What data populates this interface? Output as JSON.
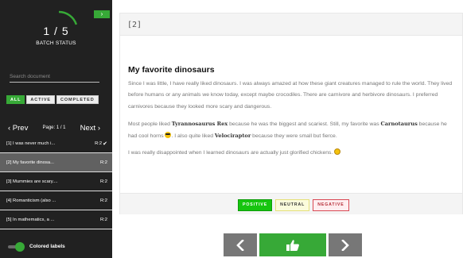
{
  "sidebar": {
    "collapse_icon": "chevron-right-icon",
    "collapse_label": "›",
    "batch": {
      "count": "1 / 5",
      "label": "BATCH STATUS",
      "progress": 0.2
    },
    "search": {
      "placeholder": "Search document",
      "value": ""
    },
    "filters": [
      {
        "label": "ALL",
        "active": true
      },
      {
        "label": "ACTIVE",
        "active": false
      },
      {
        "label": "COMPLETED",
        "active": false
      }
    ],
    "pager": {
      "prev": "‹ Prev",
      "page_label": "Page: 1 / 1",
      "next": "Next ›"
    },
    "documents": [
      {
        "title": "[1] I was never much i...",
        "rating": "R:2",
        "done": true,
        "selected": false
      },
      {
        "title": "[2] My favorite dinosa...",
        "rating": "R:2",
        "done": false,
        "selected": true
      },
      {
        "title": "[3] Mummies are scary....",
        "rating": "R:2",
        "done": false,
        "selected": false
      },
      {
        "title": "[4] Romanticism (also ...",
        "rating": "R:2",
        "done": false,
        "selected": false
      },
      {
        "title": "[5] In mathematics, a ...",
        "rating": "R:2",
        "done": false,
        "selected": false
      }
    ],
    "done_check": "✔",
    "colored_labels": {
      "label": "Colored labels",
      "on": true
    }
  },
  "document": {
    "id": "[2]",
    "title": "My favorite dinosaurs",
    "p1": "Since I was little, I have really liked dinosaurs. I was always amazed at how these giant creatures managed to rule the world. They lived before humans or any animals we know today, except maybe crocodiles. There are carnivore and herbivore dinosaurs. I preferred carnivores because they looked more scary and dangerous.",
    "p2": {
      "a": "Most people liked ",
      "b": "Tyrannosaurus Rex",
      "c": " because he was the biggest and scariest. Still, my favorite was ",
      "d": "Carnotaurus",
      "e": " because he had cool horns ",
      "f": ". I also quite liked ",
      "g": "Velociraptor",
      "h": " because they were small but fierce."
    },
    "p3": "I was really disappointed when I learned dinosaurs are actually just glorified chickens. ",
    "emoji_cool": "smiling-face-with-sunglasses-icon",
    "emoji_smile": "smiling-face-icon"
  },
  "labels": [
    {
      "label": "POSITIVE",
      "color": "#16c50f"
    },
    {
      "label": "NEUTRAL",
      "color": "#fbfbdc"
    },
    {
      "label": "NEGATIVE",
      "color": "#ffeef0"
    }
  ],
  "controls": {
    "prev_icon": "chevron-left-icon",
    "accept_icon": "thumbs-up-icon",
    "next_icon": "chevron-right-icon"
  },
  "colors": {
    "accent": "#37a937",
    "sidebar_bg": "#212121",
    "selected_row": "#616161"
  }
}
